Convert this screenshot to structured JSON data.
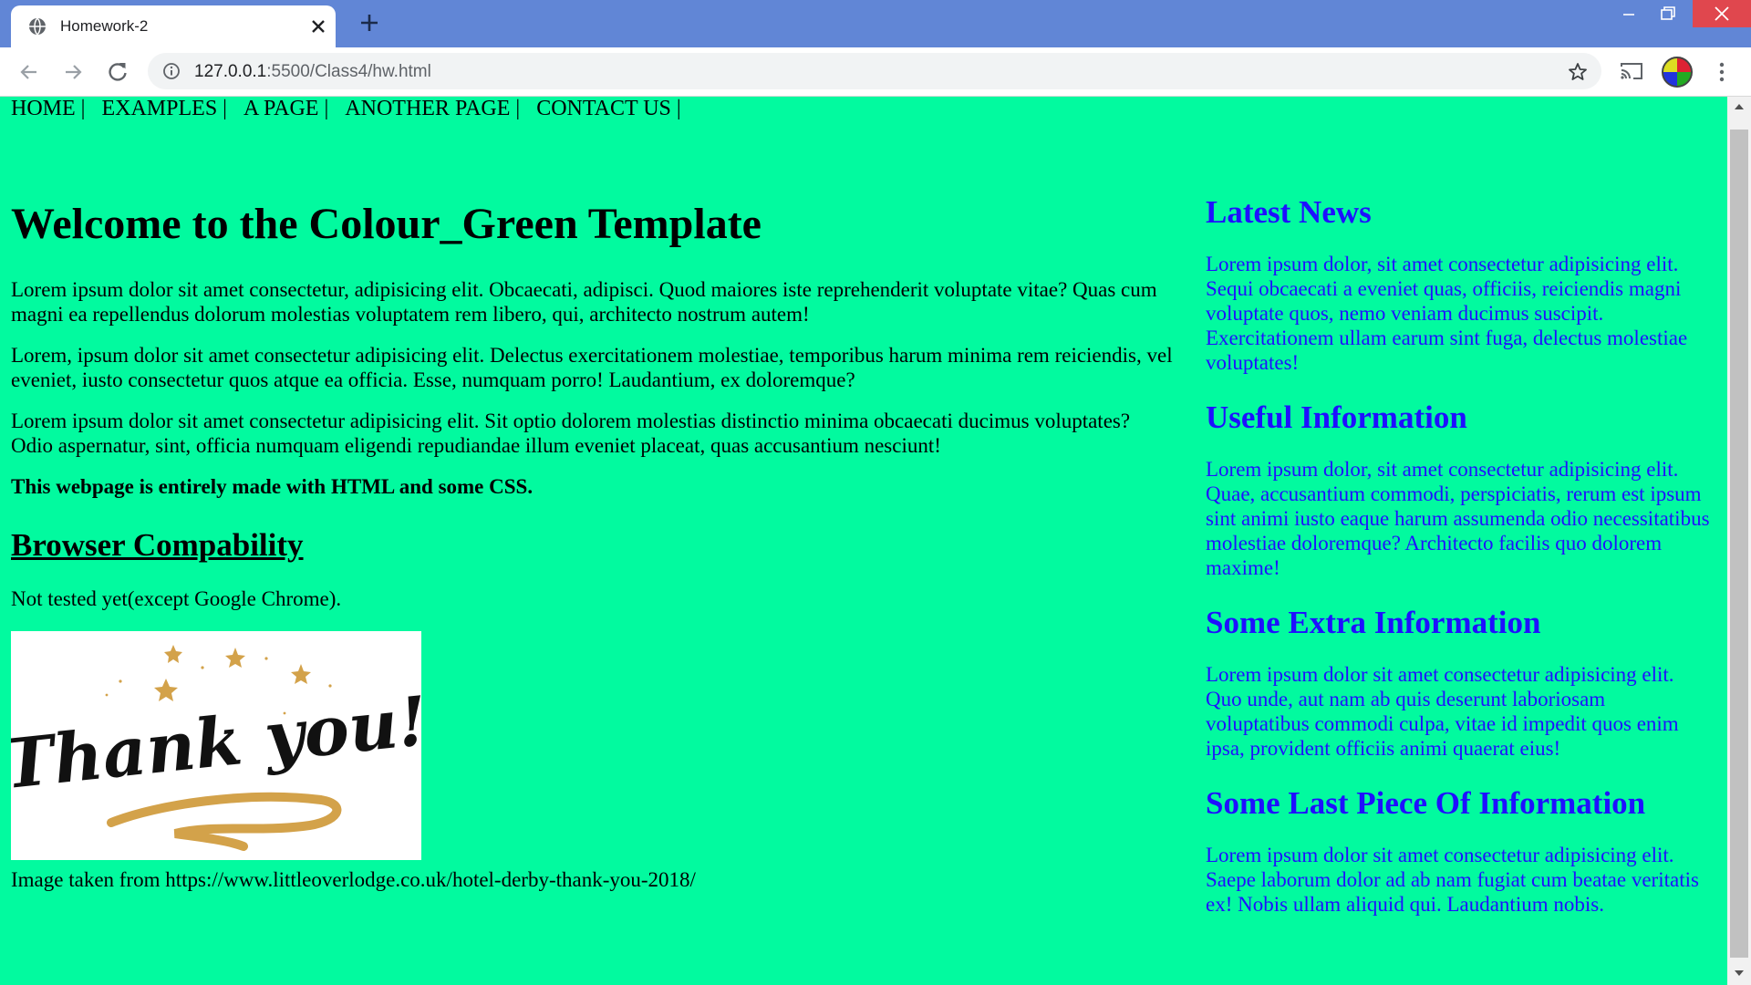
{
  "browser": {
    "tab_title": "Homework-2",
    "url_host": "127.0.0.1",
    "url_rest": ":5500/Class4/hw.html",
    "icons": [
      "globe-icon",
      "close-icon",
      "plus-icon",
      "minimize-icon",
      "restore-icon",
      "window-close-icon",
      "back-icon",
      "forward-icon",
      "reload-icon",
      "info-icon",
      "star-icon",
      "cast-icon",
      "menu-icon"
    ]
  },
  "nav": {
    "items": [
      "HOME",
      "EXAMPLES",
      "A PAGE",
      "ANOTHER PAGE",
      "CONTACT US"
    ],
    "separator": "|"
  },
  "main": {
    "title": "Welcome to the Colour_Green Template",
    "paragraphs": [
      "Lorem ipsum dolor sit amet consectetur, adipisicing elit. Obcaecati, adipisci. Quod maiores iste reprehenderit voluptate vitae? Quas cum magni ea repellendus dolorum molestias voluptatem rem libero, qui, architecto nostrum autem!",
      "Lorem, ipsum dolor sit amet consectetur adipisicing elit. Delectus exercitationem molestiae, temporibus harum minima rem reiciendis, vel eveniet, iusto consectetur quos atque ea officia. Esse, numquam porro! Laudantium, ex doloremque?",
      "Lorem ipsum dolor sit amet consectetur adipisicing elit. Sit optio dolorem molestias distinctio minima obcaecati ducimus voluptates? Odio aspernatur, sint, officia numquam eligendi repudiandae illum eveniet placeat, quas accusantium nesciunt!"
    ],
    "bold_note": "This webpage is entirely made with HTML and some CSS.",
    "compat_heading": "Browser Compability",
    "compat_text": "Not tested yet(except Google Chrome).",
    "image_text": "Thank you!",
    "image_caption": "Image taken from https://www.littleoverlodge.co.uk/hotel-derby-thank-you-2018/"
  },
  "sidebar": {
    "sections": [
      {
        "heading": "Latest News",
        "text": "Lorem ipsum dolor, sit amet consectetur adipisicing elit. Sequi obcaecati a eveniet quas, officiis, reiciendis magni voluptate quos, nemo veniam ducimus suscipit. Exercitationem ullam earum sint fuga, delectus molestiae voluptates!"
      },
      {
        "heading": "Useful Information",
        "text": "Lorem ipsum dolor, sit amet consectetur adipisicing elit. Quae, accusantium commodi, perspiciatis, rerum est ipsum sint animi iusto eaque harum assumenda odio necessitatibus molestiae doloremque? Architecto facilis quo dolorem maxime!"
      },
      {
        "heading": "Some Extra Information",
        "text": "Lorem ipsum dolor sit amet consectetur adipisicing elit. Quo unde, aut nam ab quis deserunt laboriosam voluptatibus commodi culpa, vitae id impedit quos enim ipsa, provident officiis animi quaerat eius!"
      },
      {
        "heading": "Some Last Piece Of Information",
        "text": "Lorem ipsum dolor sit amet consectetur adipisicing elit. Saepe laborum dolor ad ab nam fugiat cum beatae veritatis ex! Nobis ullam aliquid qui. Laudantium nobis."
      }
    ]
  },
  "colors": {
    "page_background": "#02fa9f",
    "sidebar_text": "#1f10ff",
    "titlebar": "#6186d6",
    "window_close": "#e0474e",
    "image_gold": "#d3a24a"
  }
}
